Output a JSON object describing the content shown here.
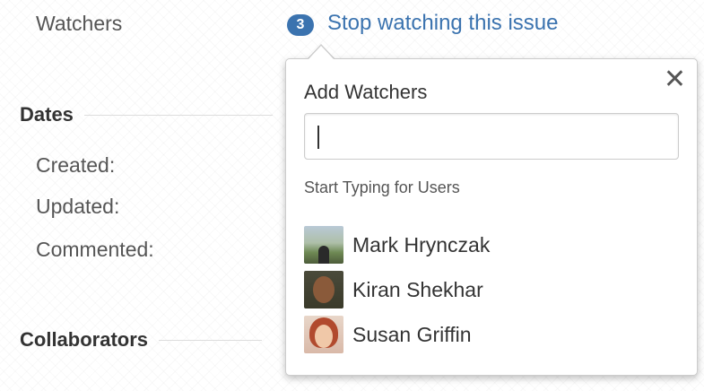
{
  "watchers": {
    "label": "Watchers",
    "count": "3",
    "stop_link": "Stop watching this issue",
    "accent_color": "#3b73af"
  },
  "dates": {
    "heading": "Dates",
    "created_label": "Created:",
    "updated_label": "Updated:",
    "commented_label": "Commented:"
  },
  "collaborators": {
    "heading": "Collaborators"
  },
  "add_watchers_popup": {
    "title": "Add Watchers",
    "input_value": "",
    "hint": "Start Typing for Users",
    "close_icon": "close-icon",
    "users": [
      {
        "name": "Mark Hrynczak"
      },
      {
        "name": "Kiran Shekhar"
      },
      {
        "name": "Susan Griffin"
      }
    ]
  }
}
